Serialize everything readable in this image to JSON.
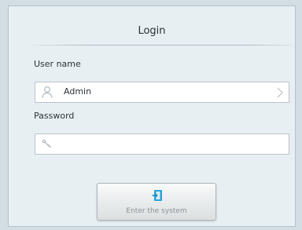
{
  "dialog": {
    "title": "Login",
    "username_label": "User name",
    "username_value": "Admin",
    "password_label": "Password",
    "password_value": "",
    "enter_button_label": "Enter the system"
  },
  "icons": {
    "username": "user-icon",
    "password": "key-icon",
    "dropdown": "chevron-right-icon",
    "enter": "door-enter-icon"
  },
  "colors": {
    "background": "#d2dde4",
    "panel": "#e8eff3",
    "enter_icon": "#2aa3d8"
  }
}
